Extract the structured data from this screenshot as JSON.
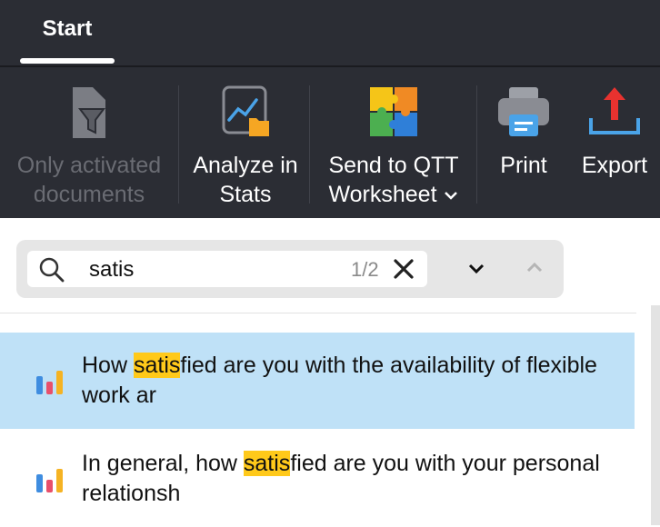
{
  "tabs": [
    {
      "label": "Start"
    }
  ],
  "ribbon": {
    "only_activated": "Only activated documents",
    "analyze": "Analyze in Stats",
    "send_line1": "Send to QTT",
    "send_line2": "Worksheet",
    "print": "Print",
    "export": "Export"
  },
  "search": {
    "query": "satis",
    "count": "1/2"
  },
  "results": [
    {
      "pre": "How ",
      "match": "satis",
      "post": "fied are you with the availability of flexible work ar",
      "selected": true
    },
    {
      "pre": "In general, how ",
      "match": "satis",
      "post": "fied are you with your personal relationsh",
      "selected": false
    }
  ],
  "colors": {
    "toolbar_bg": "#2b2d34",
    "highlight": "#ffc91a",
    "selected_row": "#bfe1f7",
    "export_arrow": "#e8322f",
    "export_tray": "#4aa3e8"
  },
  "icons": [
    "document-filter-icon",
    "stats-chart-icon",
    "puzzle-icon",
    "printer-icon",
    "export-icon",
    "search-icon",
    "clear-icon",
    "chevron-down-icon",
    "chevron-up-icon",
    "bar-chart-icon"
  ]
}
